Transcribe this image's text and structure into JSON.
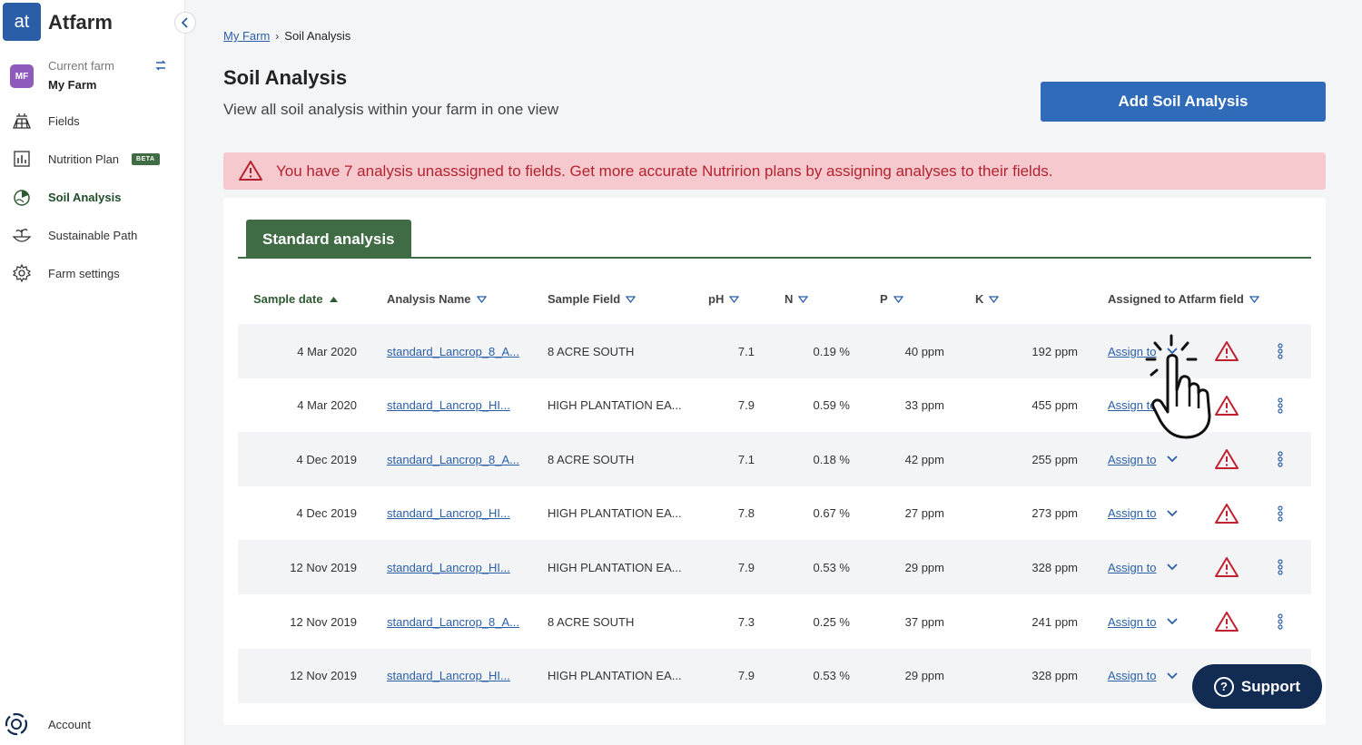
{
  "app": {
    "logo_text": "at",
    "name": "Atfarm"
  },
  "sidebar": {
    "collapse_icon": "chevron-left-icon",
    "farm": {
      "avatar": "MF",
      "label": "Current farm",
      "name": "My Farm"
    },
    "items": [
      {
        "label": "Fields",
        "icon": "field-icon",
        "active": false
      },
      {
        "label": "Nutrition Plan",
        "icon": "chart-icon",
        "badge": "BETA",
        "active": false
      },
      {
        "label": "Soil Analysis",
        "icon": "soil-analysis-icon",
        "active": true
      },
      {
        "label": "Sustainable Path",
        "icon": "sustainable-icon",
        "active": false
      },
      {
        "label": "Farm settings",
        "icon": "gear-icon",
        "active": false
      }
    ],
    "account_label": "Account"
  },
  "breadcrumb": {
    "root": "My Farm",
    "current": "Soil Analysis"
  },
  "header": {
    "title": "Soil Analysis",
    "subtitle": "View all soil analysis within your farm in one view",
    "add_button": "Add Soil Analysis"
  },
  "alert": {
    "text": "You have 7 analysis unasssigned to fields. Get more accurate Nutririon plans by assigning analyses to their fields."
  },
  "tab": {
    "label": "Standard analysis"
  },
  "table": {
    "headers": {
      "date": "Sample date",
      "name": "Analysis Name",
      "field": "Sample Field",
      "ph": "pH",
      "n": "N",
      "p": "P",
      "k": "K",
      "assigned": "Assigned to Atfarm field"
    },
    "rows": [
      {
        "date": "4 Mar 2020",
        "name": "standard_Lancrop_8_A...",
        "field": "8 ACRE SOUTH",
        "ph": "7.1",
        "n": "0.19 %",
        "p": "40 ppm",
        "k": "192 ppm",
        "assign": "Assign to"
      },
      {
        "date": "4 Mar 2020",
        "name": "standard_Lancrop_HI...",
        "field": "HIGH PLANTATION EA...",
        "ph": "7.9",
        "n": "0.59 %",
        "p": "33 ppm",
        "k": "455 ppm",
        "assign": "Assign to"
      },
      {
        "date": "4 Dec 2019",
        "name": "standard_Lancrop_8_A...",
        "field": "8 ACRE SOUTH",
        "ph": "7.1",
        "n": "0.18 %",
        "p": "42 ppm",
        "k": "255 ppm",
        "assign": "Assign to"
      },
      {
        "date": "4 Dec 2019",
        "name": "standard_Lancrop_HI...",
        "field": "HIGH PLANTATION EA...",
        "ph": "7.8",
        "n": "0.67 %",
        "p": "27 ppm",
        "k": "273 ppm",
        "assign": "Assign to"
      },
      {
        "date": "12 Nov 2019",
        "name": "standard_Lancrop_HI...",
        "field": "HIGH PLANTATION EA...",
        "ph": "7.9",
        "n": "0.53 %",
        "p": "29 ppm",
        "k": "328 ppm",
        "assign": "Assign to"
      },
      {
        "date": "12 Nov 2019",
        "name": "standard_Lancrop_8_A...",
        "field": "8 ACRE SOUTH",
        "ph": "7.3",
        "n": "0.25 %",
        "p": "37 ppm",
        "k": "241 ppm",
        "assign": "Assign to"
      },
      {
        "date": "12 Nov 2019",
        "name": "standard_Lancrop_HI...",
        "field": "HIGH PLANTATION EA...",
        "ph": "7.9",
        "n": "0.53 %",
        "p": "29 ppm",
        "k": "328 ppm",
        "assign": "Assign to"
      }
    ]
  },
  "support": {
    "label": "Support"
  },
  "colors": {
    "brand_blue": "#2f6bb8",
    "brand_green": "#3f6b45",
    "alert_bg": "#f6c9cf",
    "alert_text": "#b3232f",
    "navy": "#112b52"
  }
}
